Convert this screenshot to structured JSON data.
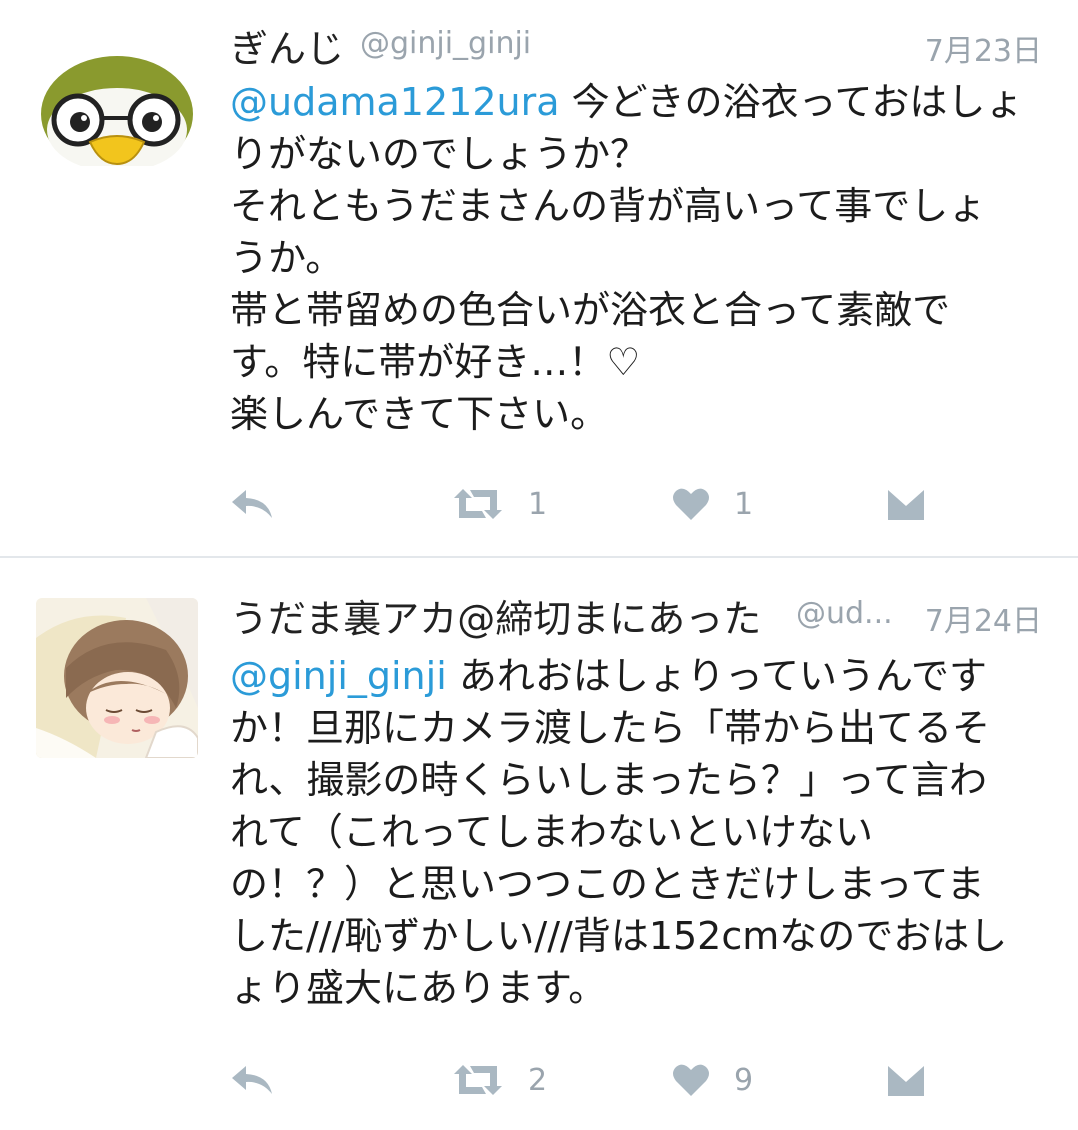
{
  "tweets": [
    {
      "name": "ぎんじ",
      "handle": "@ginji_ginji",
      "date": "7月23日",
      "mention": "@udama1212ura",
      "lines": [
        " 今どきの浴衣っておはしょ",
        "りがないのでしょうか？",
        "それともうだまさんの背が高いって事でしょ",
        "うか。",
        "帯と帯留めの色合いが浴衣と合って素敵で",
        "す。特に帯が好き…！♡",
        "楽しんできて下さい。"
      ],
      "retweets": "1",
      "likes": "1",
      "avatar_icon": "penguin-face-icon"
    },
    {
      "name": "うだま裏アカ@締切まにあった",
      "handle": "@ud...",
      "date": "7月24日",
      "mention": "@ginji_ginji",
      "lines": [
        " あれおはしょりっていうんです",
        "か！旦那にカメラ渡したら「帯から出てるそ",
        "れ、撮影の時くらいしまったら？」って言わ",
        "れて（これってしまわないといけない",
        "の！？）と思いつつこのときだけしまってま",
        "した///恥ずかしい///背は152cmなのでおはし",
        "ょり盛大にあります。"
      ],
      "retweets": "2",
      "likes": "9",
      "avatar_icon": "sleeping-girl-icon"
    }
  ],
  "colors": {
    "mention": "#2b9bd8",
    "meta": "#9aa4ad",
    "icon": "#aab8c2",
    "divider": "#e3e7eb"
  }
}
